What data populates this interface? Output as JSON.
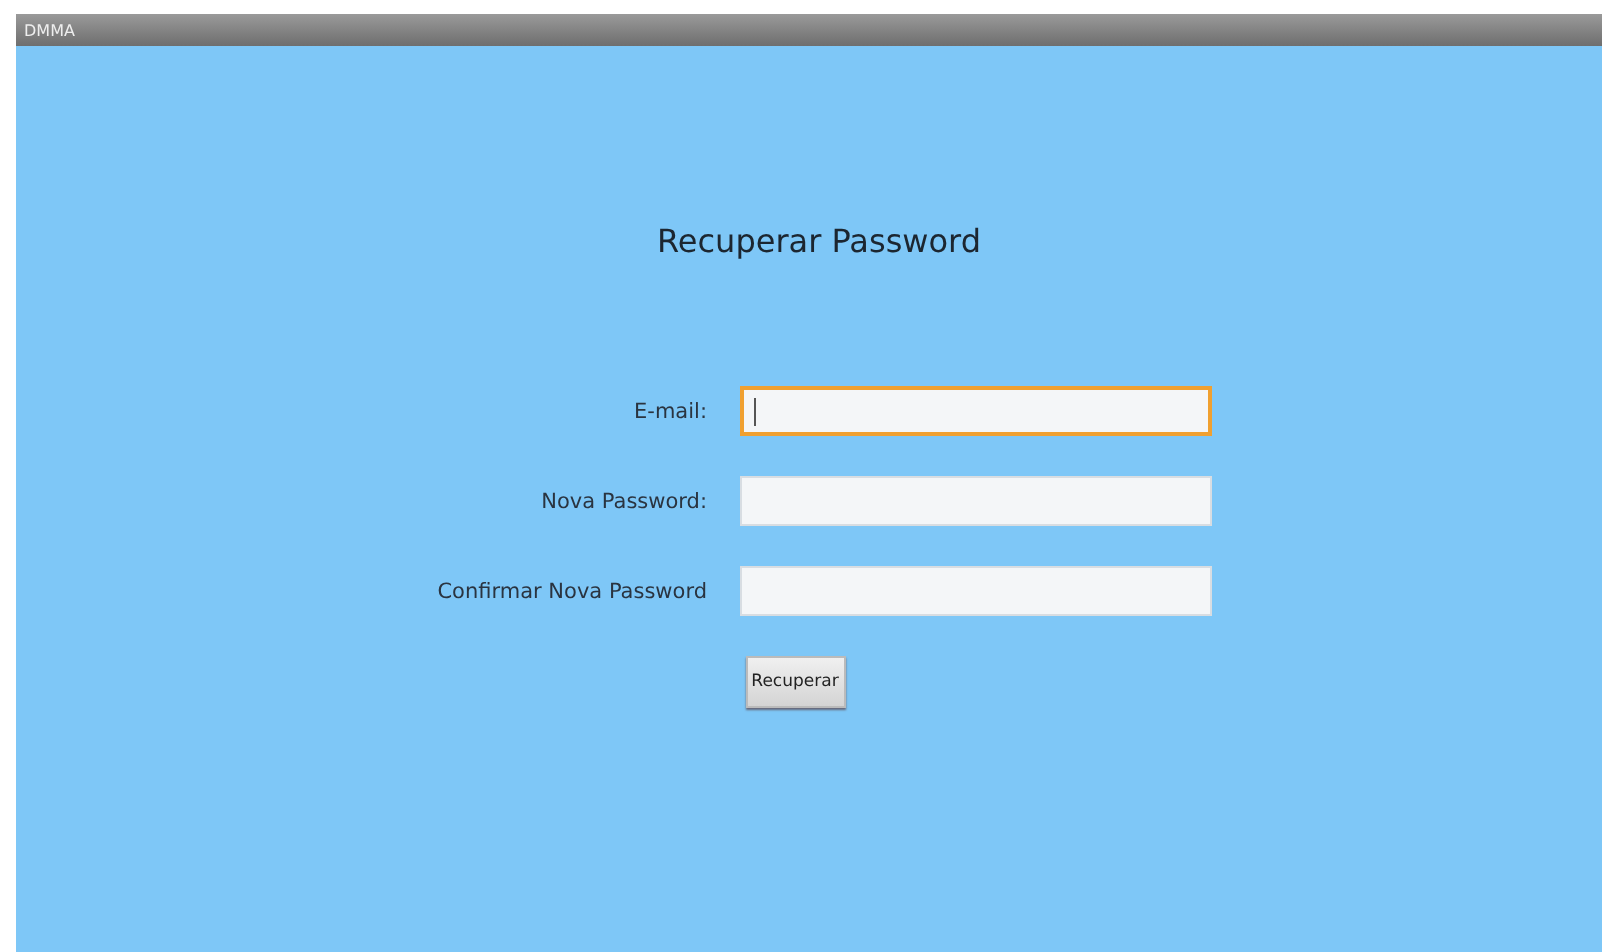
{
  "window": {
    "title": "DMMA"
  },
  "heading": "Recuperar Password",
  "fields": [
    {
      "label": "E-mail:",
      "focused": true
    },
    {
      "label": "Nova Password:",
      "focused": false
    },
    {
      "label": "Confirmar Nova Password",
      "focused": false
    }
  ],
  "button": "Recuperar"
}
